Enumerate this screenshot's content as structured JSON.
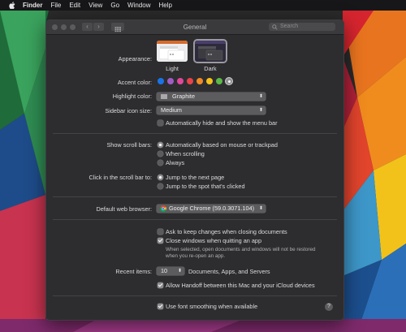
{
  "menubar": {
    "app_name": "Finder",
    "items": [
      "File",
      "Edit",
      "View",
      "Go",
      "Window",
      "Help"
    ]
  },
  "window": {
    "title": "General",
    "search_placeholder": "Search",
    "nav_back": "‹",
    "nav_forward": "›"
  },
  "appearance": {
    "label": "Appearance:",
    "options": [
      "Light",
      "Dark"
    ],
    "selected": "Dark"
  },
  "accent": {
    "label": "Accent color:",
    "colors": [
      "#1b73e8",
      "#a05cc6",
      "#e0489c",
      "#e8424a",
      "#f08b25",
      "#f4c21c",
      "#5ab848",
      "#8e8e93"
    ],
    "selected": "#8e8e93"
  },
  "highlight": {
    "label": "Highlight color:",
    "value": "Graphite"
  },
  "sidebar_icon": {
    "label": "Sidebar icon size:",
    "value": "Medium"
  },
  "menubar_autohide": {
    "label": "Automatically hide and show the menu bar",
    "checked": false
  },
  "scroll_bars": {
    "label": "Show scroll bars:",
    "options": [
      "Automatically based on mouse or trackpad",
      "When scrolling",
      "Always"
    ],
    "selected": "Automatically based on mouse or trackpad"
  },
  "click_scroll": {
    "label": "Click in the scroll bar to:",
    "options": [
      "Jump to the next page",
      "Jump to the spot that's clicked"
    ],
    "selected": "Jump to the next page"
  },
  "browser": {
    "label": "Default web browser:",
    "value": "Google Chrome (59.0.3071.104)"
  },
  "ask_keep": {
    "label": "Ask to keep changes when closing documents",
    "checked": false
  },
  "close_windows": {
    "label": "Close windows when quitting an app",
    "checked": true,
    "note_line1": "When selected, open documents and windows will not be restored",
    "note_line2": "when you re-open an app."
  },
  "recent": {
    "label": "Recent items:",
    "value": "10",
    "suffix": "Documents, Apps, and Servers"
  },
  "handoff": {
    "label": "Allow Handoff between this Mac and your iCloud devices",
    "checked": true
  },
  "font_smoothing": {
    "label": "Use font smoothing when available",
    "checked": true
  },
  "help_button": "?"
}
